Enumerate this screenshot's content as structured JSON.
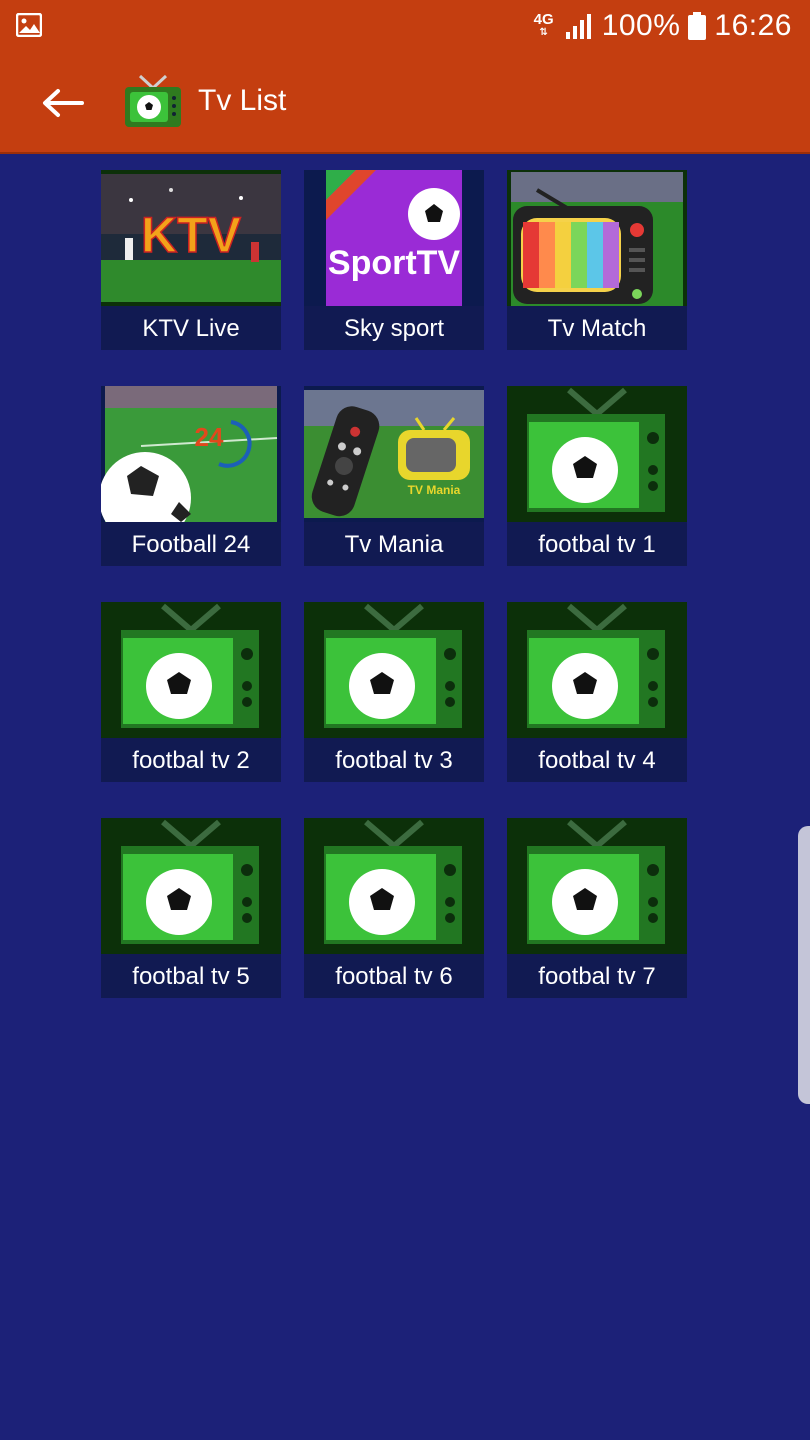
{
  "status_bar": {
    "network": "4G",
    "battery_percent": "100%",
    "time": "16:26"
  },
  "app_bar": {
    "title": "Tv List"
  },
  "channels": [
    {
      "label": "KTV Live",
      "thumb": "ktv",
      "thumb_text": "KTV"
    },
    {
      "label": "Sky sport",
      "thumb": "sporttv",
      "thumb_text": "SportTV"
    },
    {
      "label": "Tv Match",
      "thumb": "tvmatch"
    },
    {
      "label": "Football 24",
      "thumb": "football24",
      "thumb_text": "24"
    },
    {
      "label": "Tv Mania",
      "thumb": "tvmania",
      "thumb_text": "TV Mania"
    },
    {
      "label": "footbal tv 1",
      "thumb": "tvball"
    },
    {
      "label": "footbal tv 2",
      "thumb": "tvball"
    },
    {
      "label": "footbal tv 3",
      "thumb": "tvball"
    },
    {
      "label": "footbal tv 4",
      "thumb": "tvball"
    },
    {
      "label": "footbal tv 5",
      "thumb": "tvball"
    },
    {
      "label": "footbal tv 6",
      "thumb": "tvball"
    },
    {
      "label": "footbal tv 7",
      "thumb": "tvball"
    }
  ],
  "colors": {
    "status_bar": "#c43e10",
    "background": "#1c2178",
    "label_bg": "#111a52"
  }
}
